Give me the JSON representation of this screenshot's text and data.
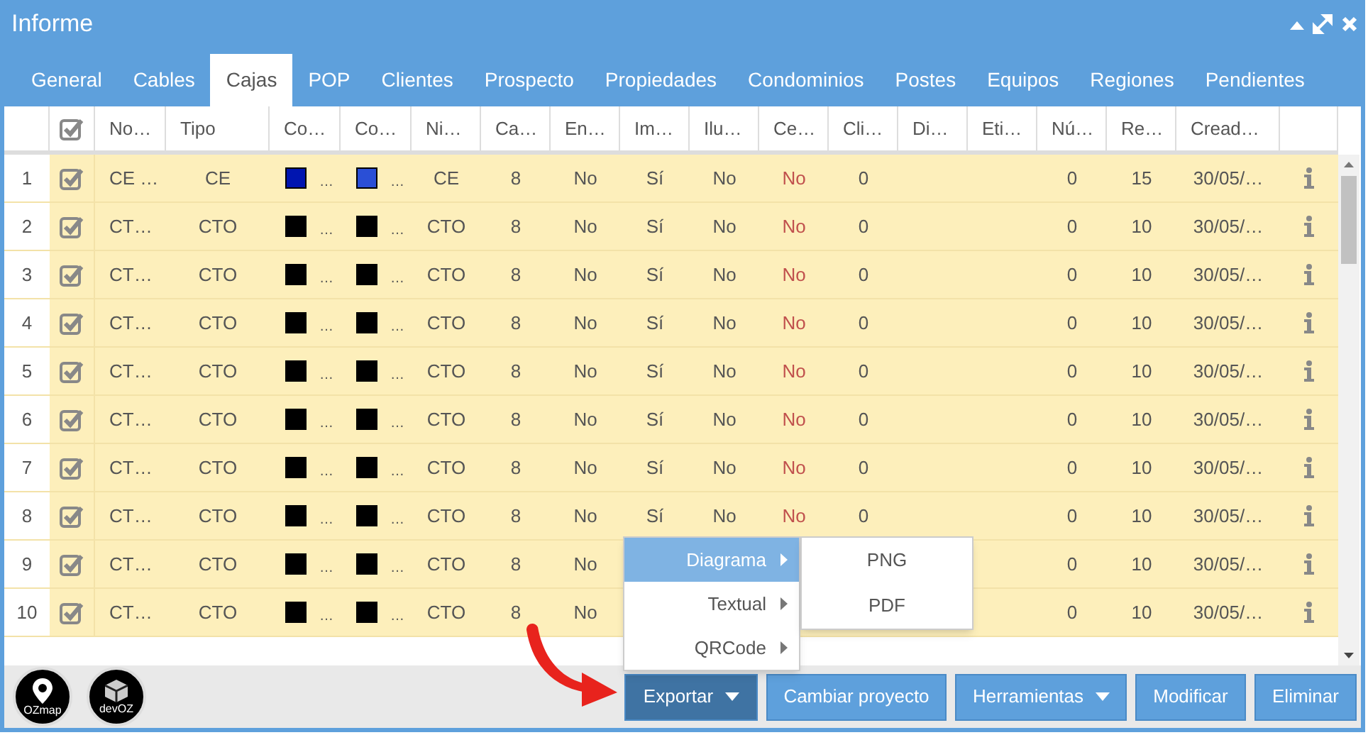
{
  "window": {
    "title": "Informe"
  },
  "tabs": [
    {
      "label": "General",
      "selected": false
    },
    {
      "label": "Cables",
      "selected": false
    },
    {
      "label": "Cajas",
      "selected": true
    },
    {
      "label": "POP",
      "selected": false
    },
    {
      "label": "Clientes",
      "selected": false
    },
    {
      "label": "Prospecto",
      "selected": false
    },
    {
      "label": "Propiedades",
      "selected": false
    },
    {
      "label": "Condominios",
      "selected": false
    },
    {
      "label": "Postes",
      "selected": false
    },
    {
      "label": "Equipos",
      "selected": false
    },
    {
      "label": "Regiones",
      "selected": false
    },
    {
      "label": "Pendientes",
      "selected": false
    }
  ],
  "table": {
    "select_all_checked": true,
    "columns": [
      {
        "label": "No…",
        "kind": "name"
      },
      {
        "label": "Tipo",
        "kind": "text"
      },
      {
        "label": "Co…",
        "kind": "swatch"
      },
      {
        "label": "Co…",
        "kind": "swatch"
      },
      {
        "label": "Ni…",
        "kind": "text"
      },
      {
        "label": "Ca…",
        "kind": "text"
      },
      {
        "label": "En…",
        "kind": "text"
      },
      {
        "label": "Im…",
        "kind": "text"
      },
      {
        "label": "Ilu…",
        "kind": "text"
      },
      {
        "label": "Ce…",
        "kind": "warn"
      },
      {
        "label": "Cli…",
        "kind": "text"
      },
      {
        "label": "Di…",
        "kind": "text"
      },
      {
        "label": "Eti…",
        "kind": "text"
      },
      {
        "label": "Nú…",
        "kind": "text"
      },
      {
        "label": "Re…",
        "kind": "text"
      },
      {
        "label": "Cread…",
        "kind": "text"
      }
    ],
    "rows": [
      {
        "number": "1",
        "checked": true,
        "cells": [
          "CE …",
          "CE",
          {
            "color": "#0015b0",
            "text": "…"
          },
          {
            "color": "#2a4fd6",
            "text": "…"
          },
          "CE",
          "8",
          "No",
          "Sí",
          "No",
          "No",
          "0",
          null,
          null,
          "0",
          "15",
          "30/05/…"
        ]
      },
      {
        "number": "2",
        "checked": true,
        "cells": [
          "CT…",
          "CTO",
          {
            "color": "#000000",
            "text": "…"
          },
          {
            "color": "#000000",
            "text": "…"
          },
          "CTO",
          "8",
          "No",
          "Sí",
          "No",
          "No",
          "0",
          null,
          null,
          "0",
          "10",
          "30/05/…"
        ]
      },
      {
        "number": "3",
        "checked": true,
        "cells": [
          "CT…",
          "CTO",
          {
            "color": "#000000",
            "text": "…"
          },
          {
            "color": "#000000",
            "text": "…"
          },
          "CTO",
          "8",
          "No",
          "Sí",
          "No",
          "No",
          "0",
          null,
          null,
          "0",
          "10",
          "30/05/…"
        ]
      },
      {
        "number": "4",
        "checked": true,
        "cells": [
          "CT…",
          "CTO",
          {
            "color": "#000000",
            "text": "…"
          },
          {
            "color": "#000000",
            "text": "…"
          },
          "CTO",
          "8",
          "No",
          "Sí",
          "No",
          "No",
          "0",
          null,
          null,
          "0",
          "10",
          "30/05/…"
        ]
      },
      {
        "number": "5",
        "checked": true,
        "cells": [
          "CT…",
          "CTO",
          {
            "color": "#000000",
            "text": "…"
          },
          {
            "color": "#000000",
            "text": "…"
          },
          "CTO",
          "8",
          "No",
          "Sí",
          "No",
          "No",
          "0",
          null,
          null,
          "0",
          "10",
          "30/05/…"
        ]
      },
      {
        "number": "6",
        "checked": true,
        "cells": [
          "CT…",
          "CTO",
          {
            "color": "#000000",
            "text": "…"
          },
          {
            "color": "#000000",
            "text": "…"
          },
          "CTO",
          "8",
          "No",
          "Sí",
          "No",
          "No",
          "0",
          null,
          null,
          "0",
          "10",
          "30/05/…"
        ]
      },
      {
        "number": "7",
        "checked": true,
        "cells": [
          "CT…",
          "CTO",
          {
            "color": "#000000",
            "text": "…"
          },
          {
            "color": "#000000",
            "text": "…"
          },
          "CTO",
          "8",
          "No",
          "Sí",
          "No",
          "No",
          "0",
          null,
          null,
          "0",
          "10",
          "30/05/…"
        ]
      },
      {
        "number": "8",
        "checked": true,
        "cells": [
          "CT…",
          "CTO",
          {
            "color": "#000000",
            "text": "…"
          },
          {
            "color": "#000000",
            "text": "…"
          },
          "CTO",
          "8",
          "No",
          "Sí",
          "No",
          "No",
          "0",
          null,
          null,
          "0",
          "10",
          "30/05/…"
        ]
      },
      {
        "number": "9",
        "checked": true,
        "cells": [
          "CT…",
          "CTO",
          {
            "color": "#000000",
            "text": "…"
          },
          {
            "color": "#000000",
            "text": "…"
          },
          "CTO",
          "8",
          "No",
          null,
          null,
          null,
          null,
          null,
          null,
          "0",
          "10",
          "30/05/…"
        ]
      },
      {
        "number": "10",
        "checked": true,
        "cells": [
          "CT…",
          "CTO",
          {
            "color": "#000000",
            "text": "…"
          },
          {
            "color": "#000000",
            "text": "…"
          },
          "CTO",
          "8",
          "No",
          null,
          null,
          null,
          null,
          null,
          null,
          "0",
          "10",
          "30/05/…"
        ]
      }
    ]
  },
  "export_menu": {
    "items": [
      {
        "label": "Diagrama",
        "selected": true
      },
      {
        "label": "Textual",
        "selected": false
      },
      {
        "label": "QRCode",
        "selected": false
      }
    ],
    "submenu": [
      "PNG",
      "PDF"
    ]
  },
  "logos": [
    "OZmap",
    "devOZ"
  ],
  "buttons": [
    {
      "label": "Exportar",
      "dropdown": true,
      "selected": true
    },
    {
      "label": "Cambiar proyecto",
      "dropdown": false,
      "selected": false
    },
    {
      "label": "Herramientas",
      "dropdown": true,
      "selected": false
    },
    {
      "label": "Modificar",
      "dropdown": false,
      "selected": false
    },
    {
      "label": "Eliminar",
      "dropdown": false,
      "selected": false
    }
  ]
}
